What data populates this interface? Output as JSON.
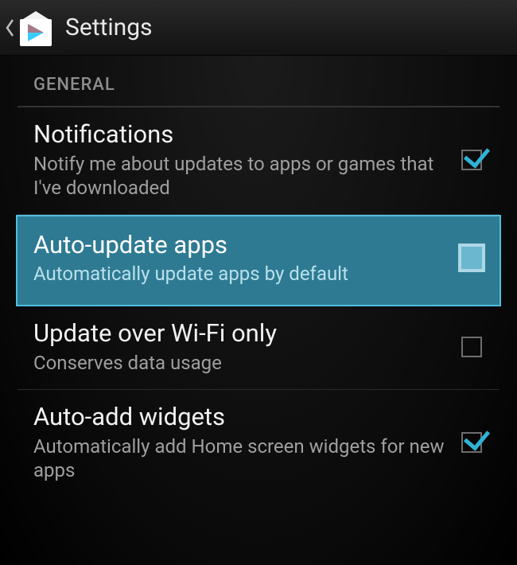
{
  "header": {
    "title": "Settings"
  },
  "section": {
    "label": "GENERAL"
  },
  "items": [
    {
      "title": "Notifications",
      "subtitle": "Notify me about updates to apps or games that I've downloaded",
      "checked": true,
      "selected": false
    },
    {
      "title": "Auto-update apps",
      "subtitle": "Automatically update apps by default",
      "checked": false,
      "selected": true
    },
    {
      "title": "Update over Wi-Fi only",
      "subtitle": "Conserves data usage",
      "checked": false,
      "selected": false
    },
    {
      "title": "Auto-add widgets",
      "subtitle": "Automatically add Home screen widgets for new apps",
      "checked": true,
      "selected": false
    }
  ]
}
